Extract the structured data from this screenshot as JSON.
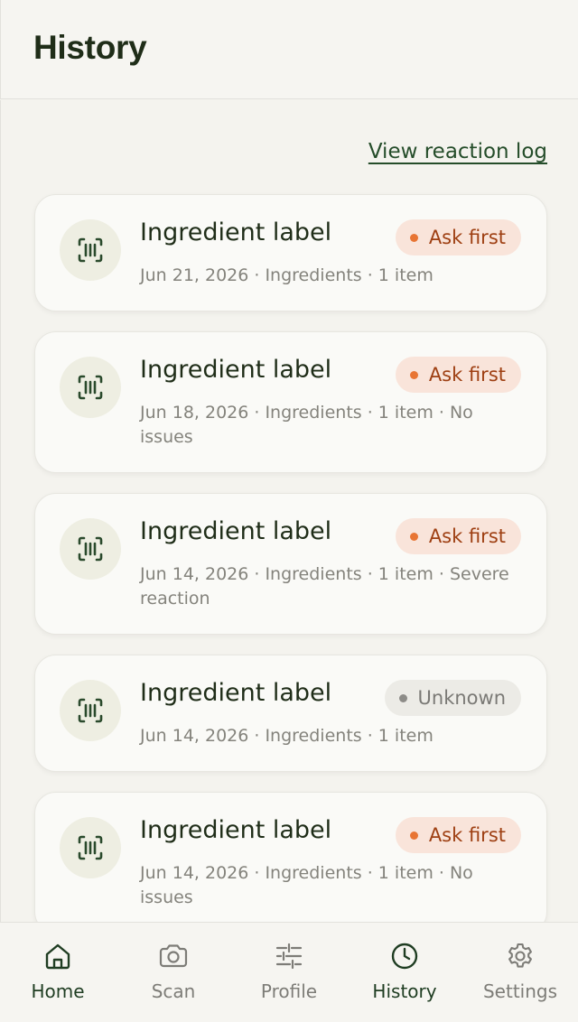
{
  "header": {
    "title": "History"
  },
  "main": {
    "reaction_log_link": "View reaction log",
    "cards": [
      {
        "title": "Ingredient label",
        "meta": "Jun 21, 2026 · Ingredients · 1 item",
        "badge": "Ask first",
        "badge_kind": "ask"
      },
      {
        "title": "Ingredient label",
        "meta": "Jun 18, 2026 · Ingredients · 1 item · No issues",
        "badge": "Ask first",
        "badge_kind": "ask"
      },
      {
        "title": "Ingredient label",
        "meta": "Jun 14, 2026 · Ingredients · 1 item · Severe reaction",
        "badge": "Ask first",
        "badge_kind": "ask"
      },
      {
        "title": "Ingredient label",
        "meta": "Jun 14, 2026 · Ingredients · 1 item",
        "badge": "Unknown",
        "badge_kind": "unknown"
      },
      {
        "title": "Ingredient label",
        "meta": "Jun 14, 2026 · Ingredients · 1 item · No issues",
        "badge": "Ask first",
        "badge_kind": "ask"
      }
    ]
  },
  "tabbar": {
    "items": [
      {
        "label": "Home",
        "icon": "home-icon",
        "active": true
      },
      {
        "label": "Scan",
        "icon": "camera-icon",
        "active": false
      },
      {
        "label": "Profile",
        "icon": "sliders-icon",
        "active": false
      },
      {
        "label": "History",
        "icon": "clock-icon",
        "active": true
      },
      {
        "label": "Settings",
        "icon": "gear-icon",
        "active": false
      }
    ]
  },
  "colors": {
    "brand_green": "#254d2a",
    "ask_first_bg": "#f9e4da",
    "ask_first_text": "#9e3f12",
    "ask_first_dot": "#e87534",
    "unknown_bg": "#ecebe6",
    "unknown_text": "#7a7975"
  }
}
